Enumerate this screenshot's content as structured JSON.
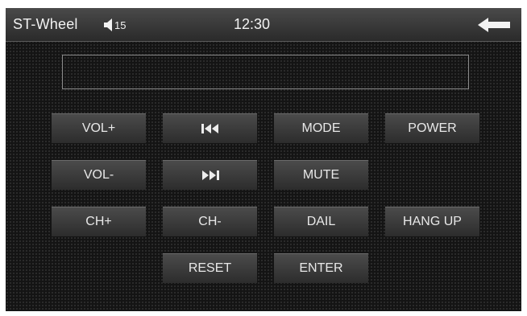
{
  "header": {
    "title": "ST-Wheel",
    "volume_icon": "speaker-icon",
    "volume_level": "15",
    "time": "12:30",
    "back_icon": "back-arrow-icon"
  },
  "display": {
    "text": ""
  },
  "buttons": {
    "vol_up": "VOL+",
    "prev_icon": "skip-previous-icon",
    "mode": "MODE",
    "power": "POWER",
    "vol_down": "VOL-",
    "next_icon": "skip-next-icon",
    "mute": "MUTE",
    "ch_up": "CH+",
    "ch_down": "CH-",
    "dail": "DAIL",
    "hang_up": "HANG UP",
    "reset": "RESET",
    "enter": "ENTER"
  },
  "colors": {
    "background": "#141414",
    "button_top": "#4b4b4b",
    "button_bottom": "#2c2c2c",
    "text": "#e8e8e8"
  }
}
